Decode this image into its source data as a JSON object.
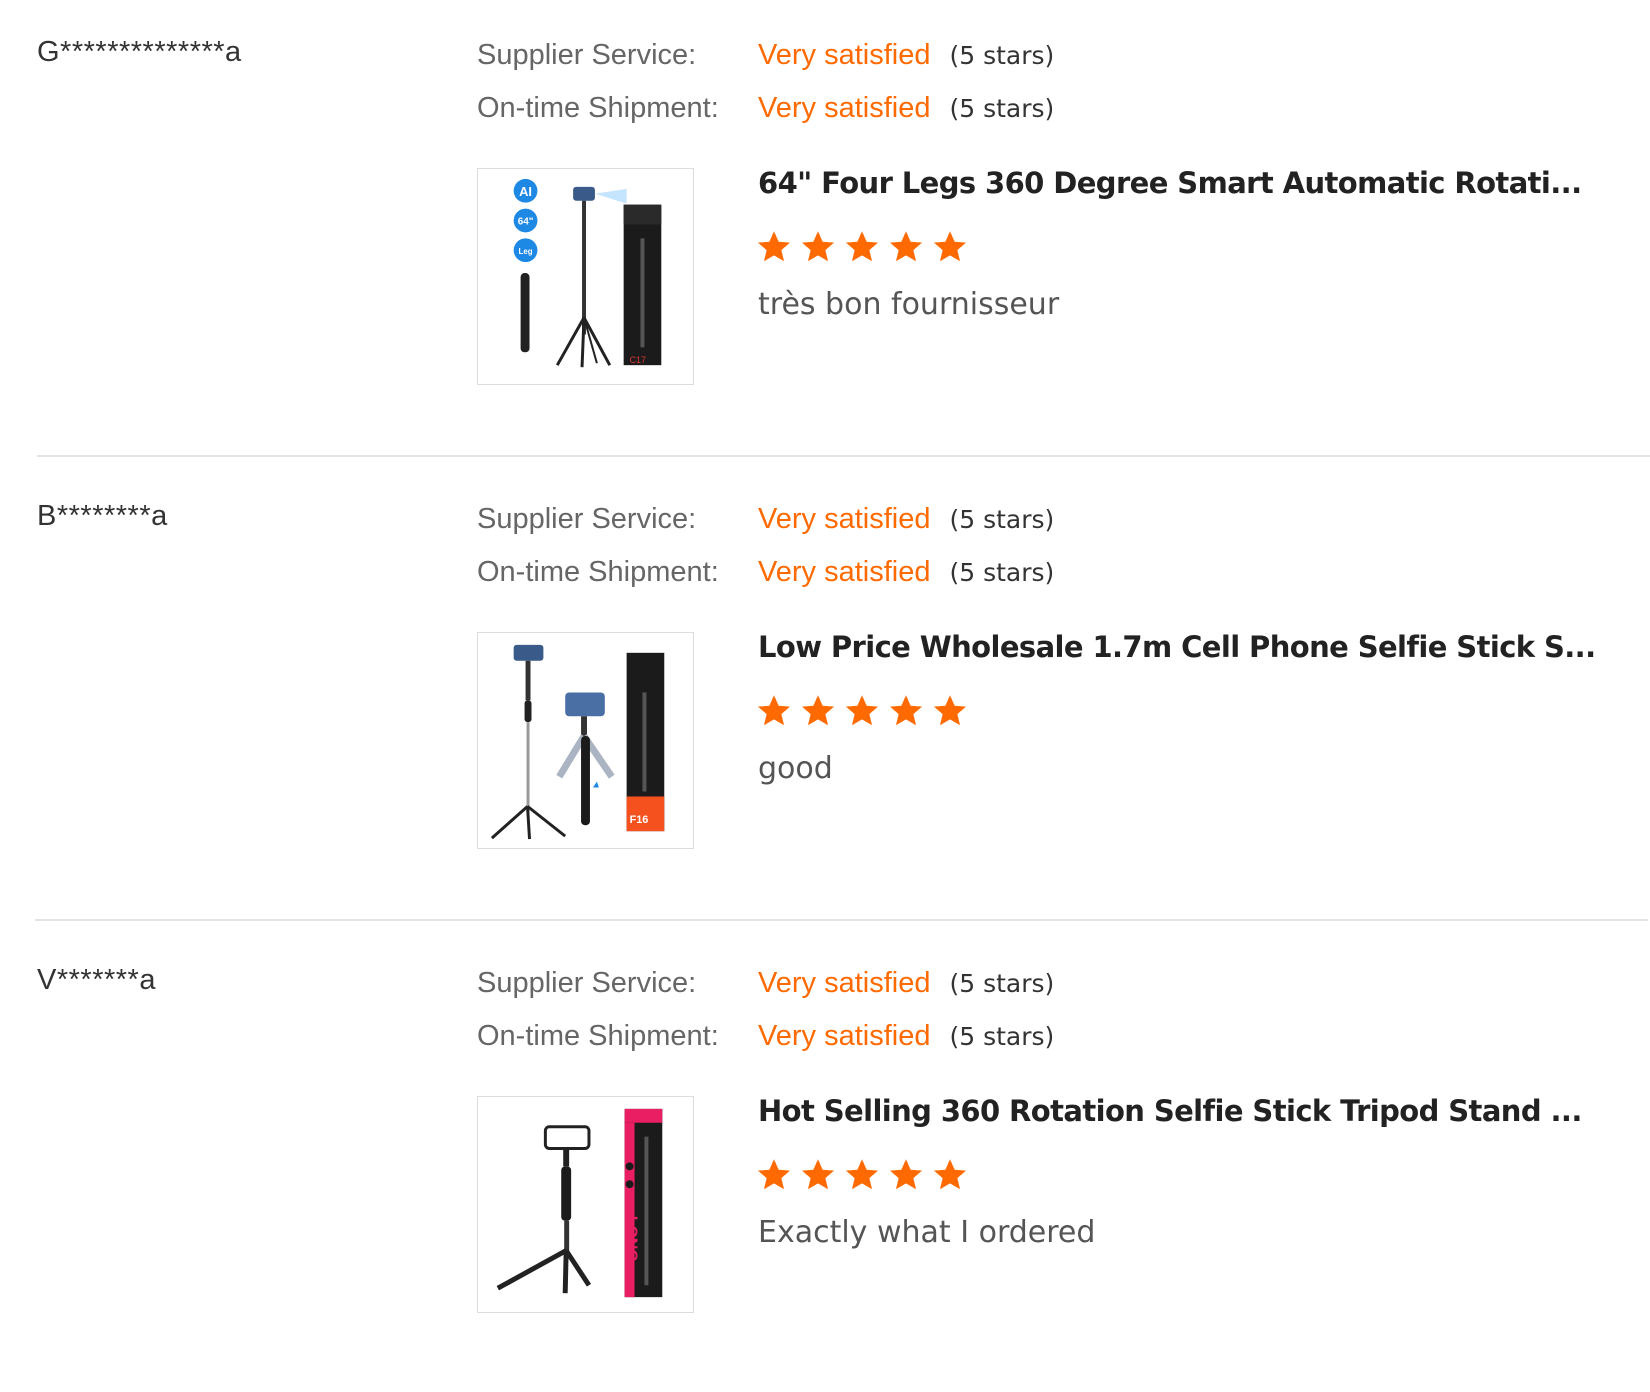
{
  "colors": {
    "accent": "#ff6a00",
    "label": "#666666",
    "text": "#333333",
    "divider": "#e3e3e3"
  },
  "reviews": [
    {
      "reviewer": "G**************a",
      "supplier_service_label": "Supplier Service:",
      "supplier_service_value": "Very satisfied",
      "supplier_service_stars": "(5 stars)",
      "shipment_label": "On-time Shipment:",
      "shipment_value": "Very satisfied",
      "shipment_stars": "(5 stars)",
      "product_title": "64\" Four Legs 360 Degree Smart Automatic Rotati...",
      "product_image_icon": "tripod-product-image",
      "rating": 5,
      "comment": "très bon fournisseur"
    },
    {
      "reviewer": "B********a",
      "supplier_service_label": "Supplier Service:",
      "supplier_service_value": "Very satisfied",
      "supplier_service_stars": "(5 stars)",
      "shipment_label": "On-time Shipment:",
      "shipment_value": "Very satisfied",
      "shipment_stars": "(5 stars)",
      "product_title": "Low Price Wholesale 1.7m Cell Phone Selfie Stick S...",
      "product_image_icon": "selfie-stick-product-image",
      "rating": 5,
      "comment": "good"
    },
    {
      "reviewer": "V*******a",
      "supplier_service_label": "Supplier Service:",
      "supplier_service_value": "Very satisfied",
      "supplier_service_stars": "(5 stars)",
      "shipment_label": "On-time Shipment:",
      "shipment_value": "Very satisfied",
      "shipment_stars": "(5 stars)",
      "product_title": "Hot Selling 360 Rotation Selfie Stick Tripod Stand ...",
      "product_image_icon": "tripod-stand-product-image",
      "rating": 5,
      "comment": "Exactly what I ordered"
    }
  ]
}
